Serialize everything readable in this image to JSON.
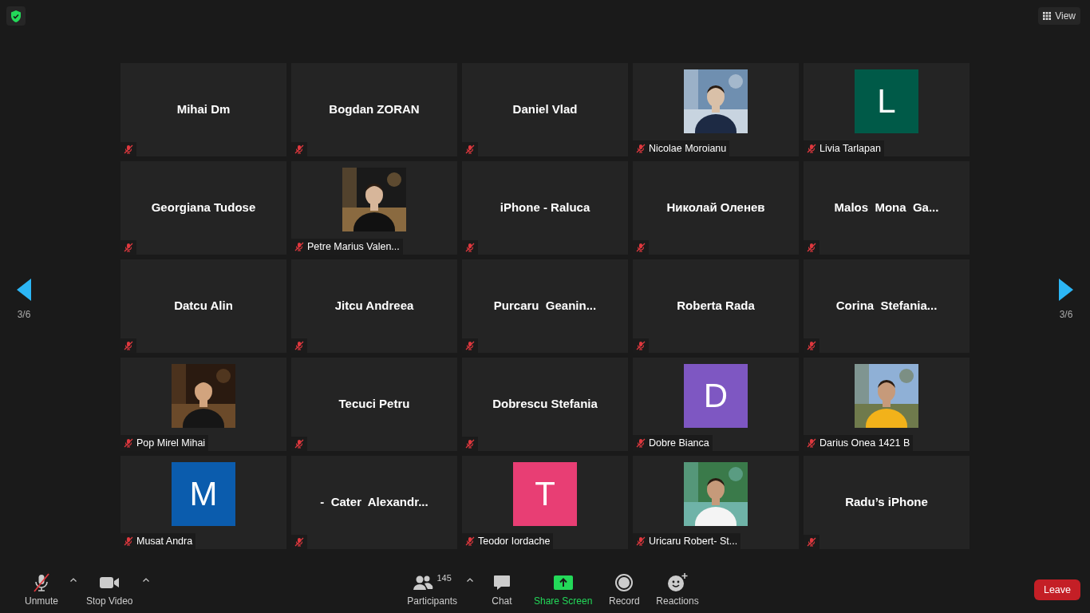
{
  "top_bar": {
    "security": true,
    "view_button": "View"
  },
  "navigation": {
    "previous_page": "3/6",
    "next_page": "3/6"
  },
  "tiles": [
    {
      "kind": "name",
      "name": "Mihai Dm",
      "muted": true
    },
    {
      "kind": "name",
      "name": "Bogdan ZORAN",
      "muted": true
    },
    {
      "kind": "name",
      "name": "Daniel Vlad",
      "muted": true
    },
    {
      "name": "Nicolae Moroianu",
      "muted": true
    },
    {
      "kind": "avatar",
      "name": "Livia Tarlapan",
      "letter": "L",
      "color": "#005a48",
      "muted": true
    },
    {
      "kind": "name",
      "name": "Georgiana Tudose",
      "muted": true
    },
    {
      "name": "Petre Marius Valen...",
      "muted": true
    },
    {
      "kind": "name",
      "name": "iPhone - Raluca",
      "muted": true
    },
    {
      "kind": "name",
      "name": "Николай Оленев",
      "muted": true
    },
    {
      "kind": "name",
      "name": "Malos  Mona  Ga...",
      "muted": true
    },
    {
      "kind": "name",
      "name": "Datcu Alin",
      "muted": true
    },
    {
      "kind": "name",
      "name": "Jitcu Andreea",
      "muted": true
    },
    {
      "kind": "name",
      "name": "Purcaru  Geanin...",
      "muted": true
    },
    {
      "kind": "name",
      "name": "Roberta Rada",
      "muted": true
    },
    {
      "kind": "name",
      "name": "Corina  Stefania...",
      "muted": true
    },
    {
      "name": "Pop Mirel Mihai",
      "muted": true
    },
    {
      "kind": "name",
      "name": "Tecuci Petru",
      "muted": true
    },
    {
      "kind": "name",
      "name": "Dobrescu Stefania",
      "muted": true
    },
    {
      "kind": "avatar",
      "name": "Dobre Bianca",
      "letter": "D",
      "color": "#7e57c2",
      "muted": true
    },
    {
      "name": "Darius Onea 1421 B",
      "muted": true
    },
    {
      "kind": "avatar",
      "name": "Musat Andra",
      "letter": "M",
      "color": "#0b5cad",
      "muted": true
    },
    {
      "kind": "name",
      "name": "-  Cater  Alexandr...",
      "muted": true
    },
    {
      "kind": "avatar",
      "name": "Teodor Iordache",
      "letter": "T",
      "color": "#e83e74",
      "muted": true
    },
    {
      "name": "Uricaru Robert- St...",
      "muted": true
    },
    {
      "kind": "name",
      "name": "Radu’s iPhone",
      "muted": true
    }
  ],
  "toolbar": [
    {
      "kind": "mic",
      "label": "Unmute",
      "muted": true,
      "menu": true
    },
    {
      "kind": "video",
      "label": "Stop Video",
      "menu": true
    },
    {
      "kind": "participants",
      "label": "Participants",
      "count": "145",
      "menu": true
    },
    {
      "kind": "chat",
      "label": "Chat"
    },
    {
      "kind": "share",
      "label": "Share Screen"
    },
    {
      "kind": "record",
      "label": "Record"
    },
    {
      "kind": "reactions",
      "label": "Reactions"
    }
  ],
  "leave_button": "Leave"
}
